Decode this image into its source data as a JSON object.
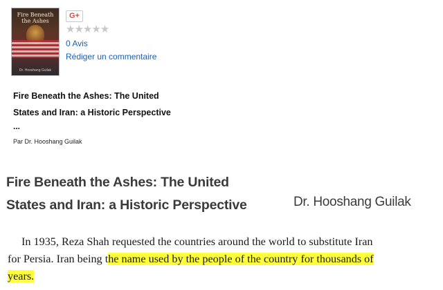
{
  "product": {
    "cover": {
      "title": "Fire Beneath the Ashes",
      "author": "Dr. Hooshang Guilak"
    },
    "share_button_label": "G+",
    "rating": {
      "stars_filled": 0,
      "stars_total": 5,
      "stars_display": "★★★★★"
    },
    "reviews_count_label": "0 Avis",
    "write_review_label": "Rédiger un commentaire",
    "title_line1": "Fire Beneath the Ashes: The United",
    "title_line2": "States and Iran: a Historic Perspective",
    "title_ellipsis": "...",
    "author_line": "Par Dr. Hooshang Guilak"
  },
  "excerpt": {
    "title_line1": "Fire Beneath the Ashes: The United",
    "title_line2": "States and Iran: a Historic Perspective",
    "author": "Dr. Hooshang Guilak",
    "para_line1": "In 1935, Reza Shah requested the countries around the world to substitute Iran",
    "para_line2_plain": "for Persia. Iran being t",
    "para_line2_highlight": "he name used by the people of the country for thousands of",
    "para_line3_highlight": "years."
  },
  "colors": {
    "link": "#1a5fb4",
    "highlight": "#ffff3b",
    "gplus_red": "#dd4b39",
    "star_empty": "#c8c8c8"
  }
}
